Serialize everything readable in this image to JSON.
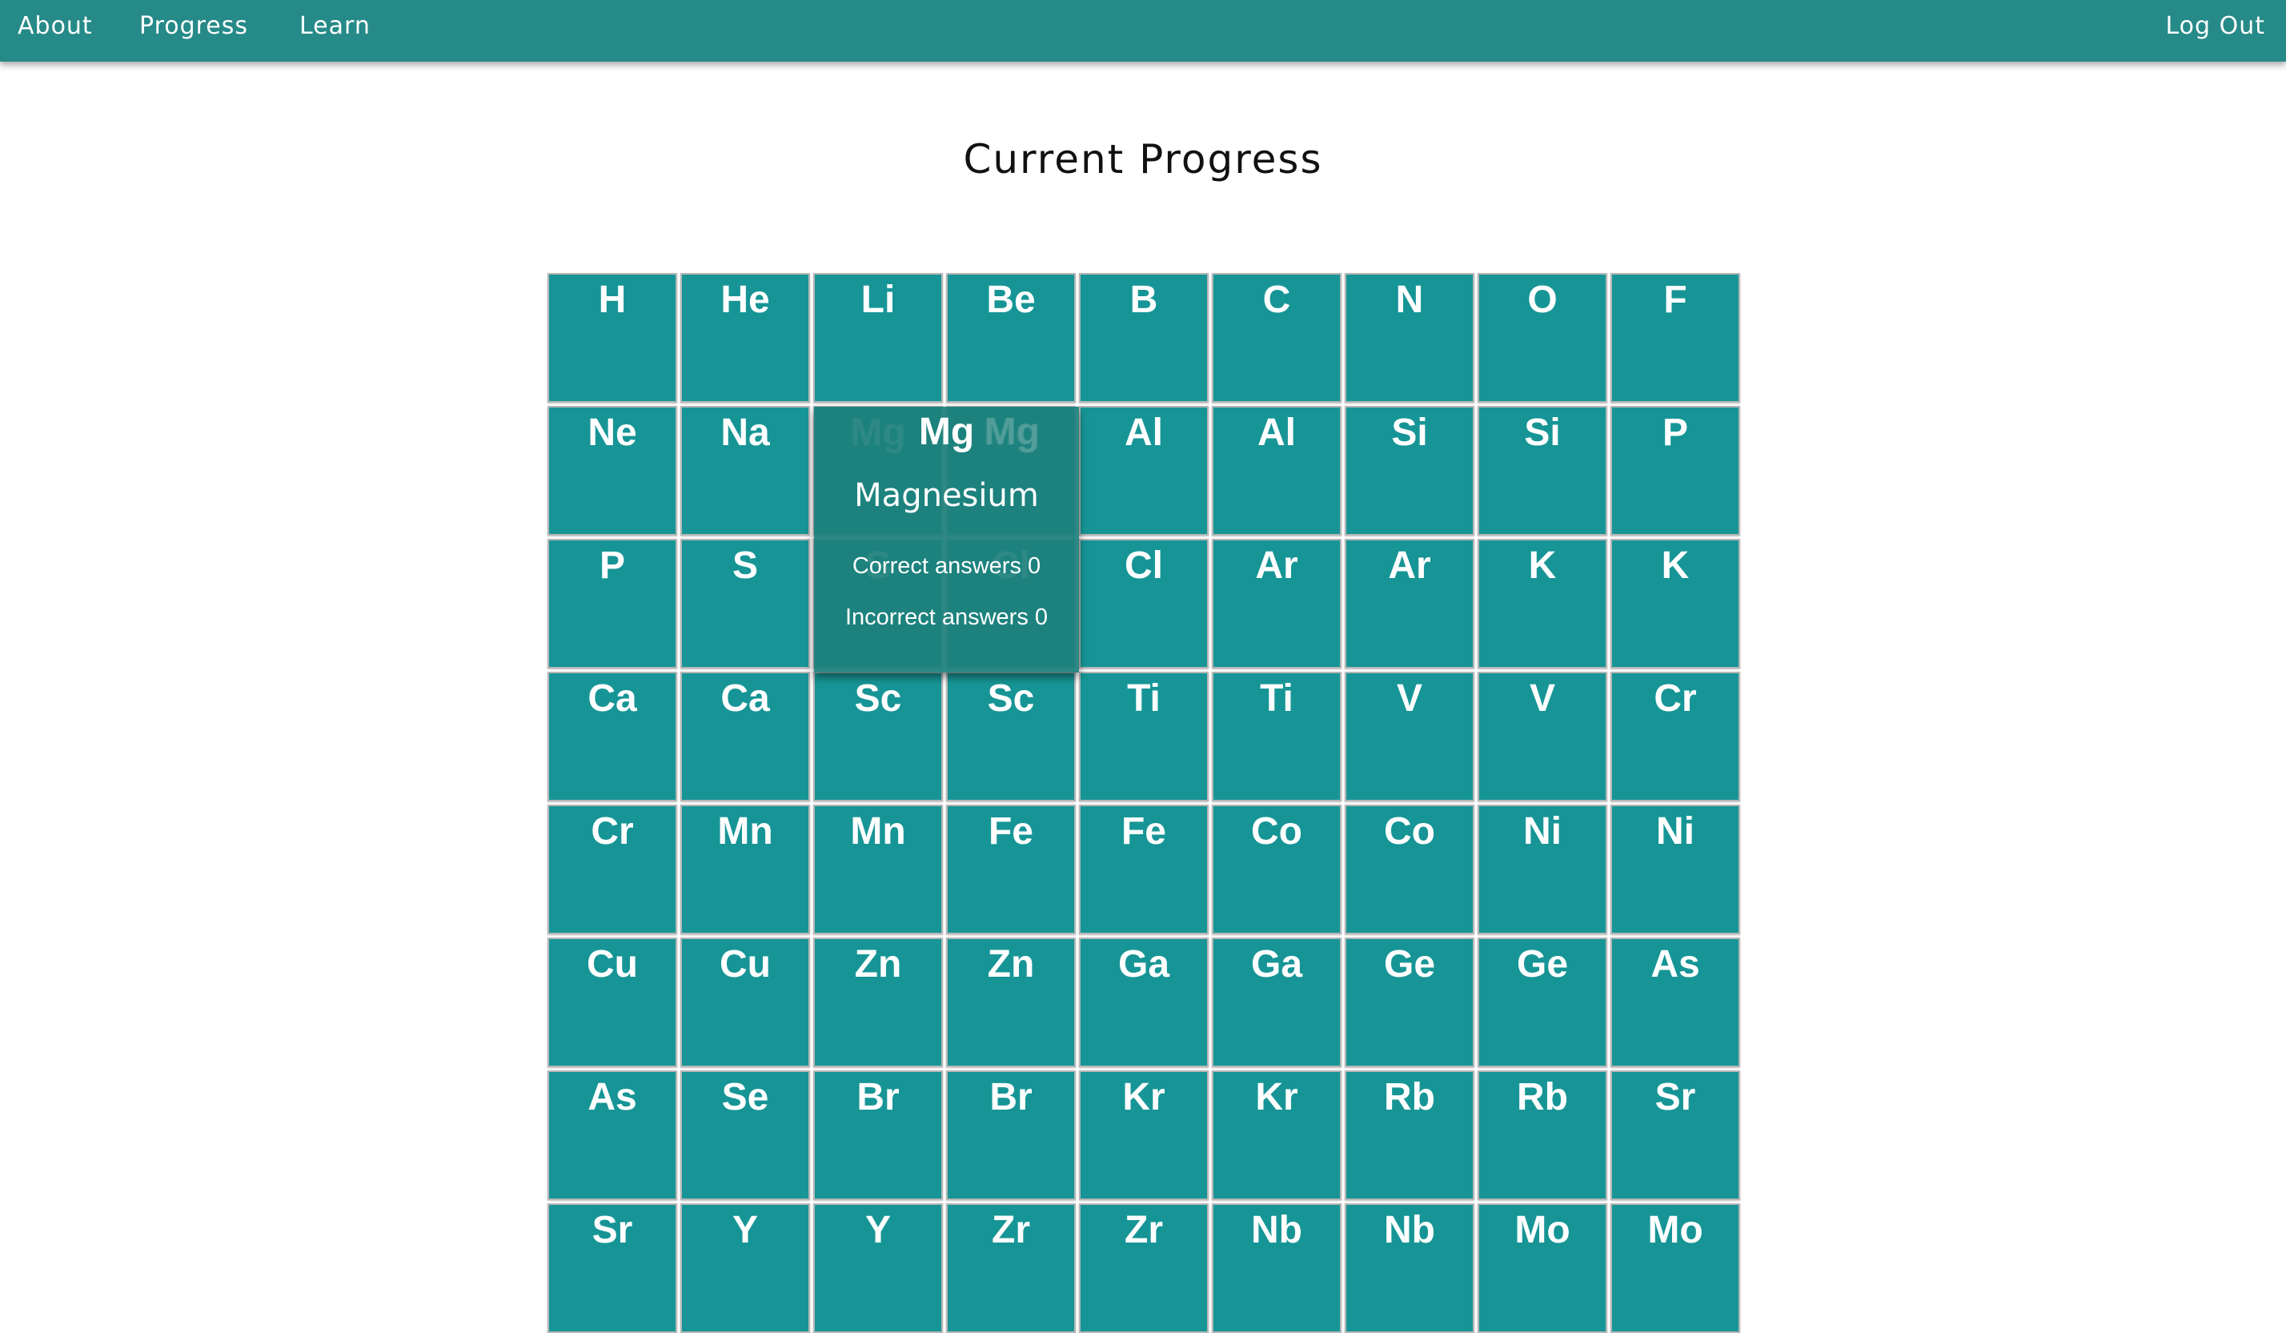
{
  "nav": {
    "about": "About",
    "progress": "Progress",
    "learn": "Learn",
    "logout": "Log Out"
  },
  "page": {
    "title": "Current Progress"
  },
  "colors": {
    "navbar": "#268a88",
    "tile": "#179596",
    "tooltip": "#1e807c"
  },
  "elements": [
    "H",
    "He",
    "Li",
    "Be",
    "B",
    "C",
    "N",
    "O",
    "F",
    "Ne",
    "Na",
    "Mg",
    "Mg",
    "Al",
    "Al",
    "Si",
    "Si",
    "P",
    "P",
    "S",
    "S",
    "Cl",
    "Cl",
    "Ar",
    "Ar",
    "K",
    "K",
    "Ca",
    "Ca",
    "Sc",
    "Sc",
    "Ti",
    "Ti",
    "V",
    "V",
    "Cr",
    "Cr",
    "Mn",
    "Mn",
    "Fe",
    "Fe",
    "Co",
    "Co",
    "Ni",
    "Ni",
    "Cu",
    "Cu",
    "Zn",
    "Zn",
    "Ga",
    "Ga",
    "Ge",
    "Ge",
    "As",
    "As",
    "Se",
    "Br",
    "Br",
    "Kr",
    "Kr",
    "Rb",
    "Rb",
    "Sr",
    "Sr",
    "Y",
    "Y",
    "Zr",
    "Zr",
    "Nb",
    "Nb",
    "Mo",
    "Mo"
  ],
  "tooltip": {
    "symbol": "Mg",
    "name": "Magnesium",
    "correct": "Correct answers 0",
    "incorrect": "Incorrect answers 0"
  }
}
